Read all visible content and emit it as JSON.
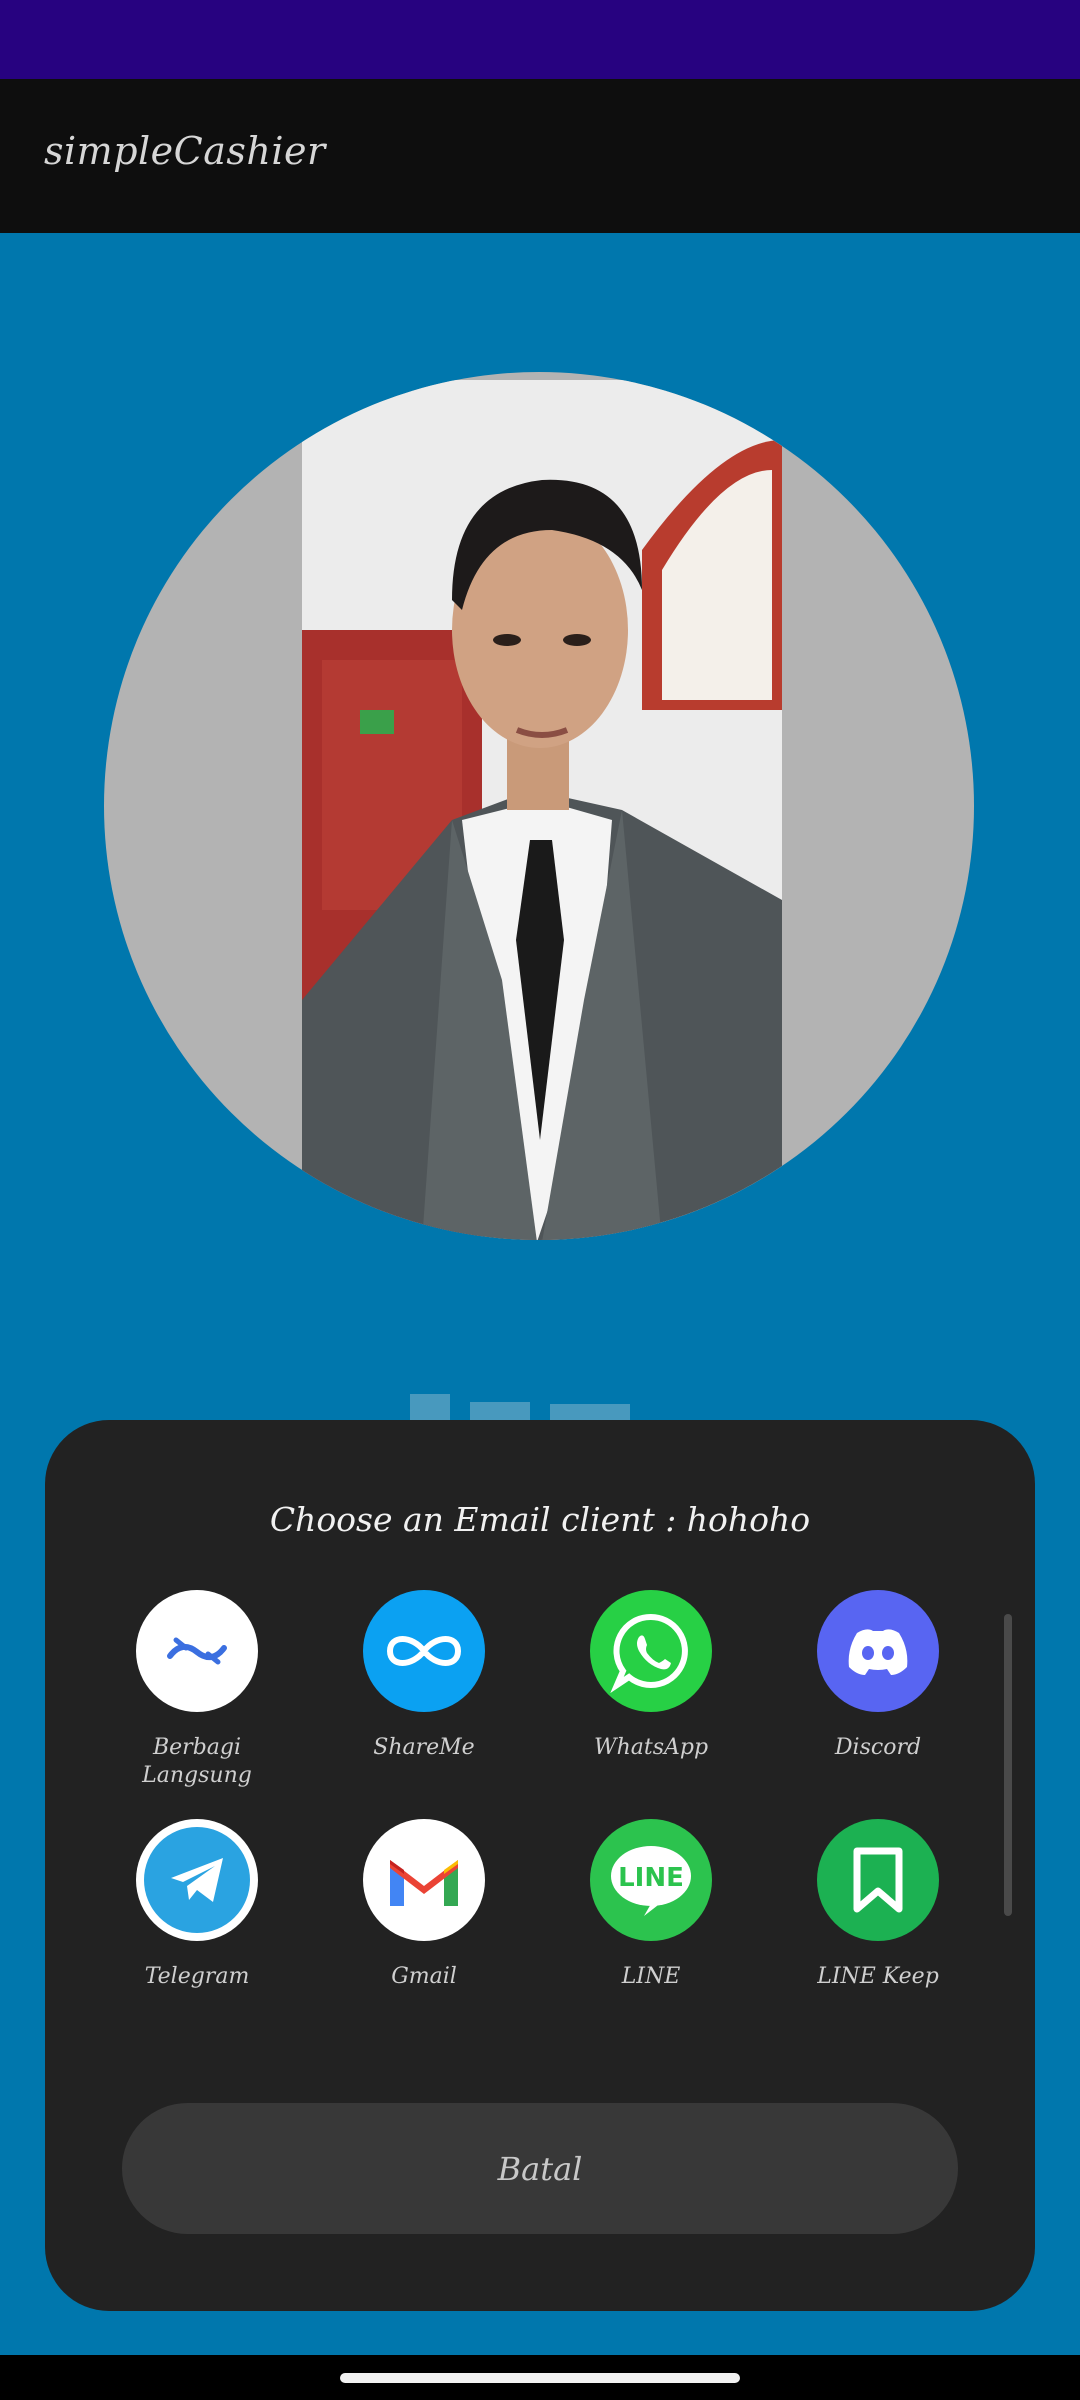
{
  "app": {
    "title": "simpleCashier"
  },
  "share_sheet": {
    "title": "Choose an Email client : hohoho",
    "apps": [
      {
        "label": "Berbagi\nLangsung",
        "icon": "berbagi-langsung-icon",
        "color": "#ffffff"
      },
      {
        "label": "ShareMe",
        "icon": "shareme-icon",
        "color": "#0ba1f2"
      },
      {
        "label": "WhatsApp",
        "icon": "whatsapp-icon",
        "color": "#27d045"
      },
      {
        "label": "Discord",
        "icon": "discord-icon",
        "color": "#5865f2"
      },
      {
        "label": "Telegram",
        "icon": "telegram-icon",
        "color": "#2aa3e1"
      },
      {
        "label": "Gmail",
        "icon": "gmail-icon",
        "color": "#ffffff"
      },
      {
        "label": "LINE",
        "icon": "line-icon",
        "color": "#2cc34e"
      },
      {
        "label": "LINE Keep",
        "icon": "line-keep-icon",
        "color": "#1cb152"
      }
    ],
    "cancel_label": "Batal"
  },
  "colors": {
    "background": "#0077AD",
    "status_bar": "#270280",
    "app_bar": "#0e0e0e",
    "sheet": "#222222",
    "cancel_button": "#383838"
  }
}
